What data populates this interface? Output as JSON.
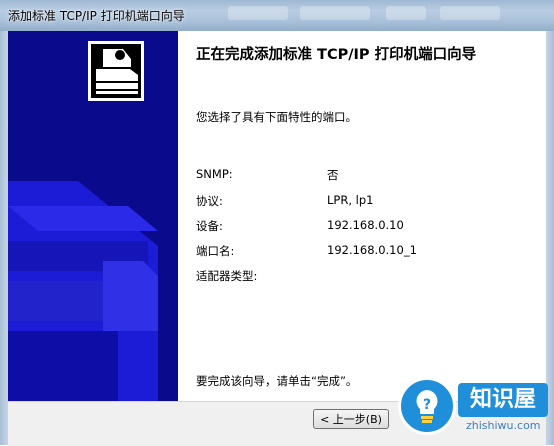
{
  "window": {
    "title": "添加标准 TCP/IP 打印机端口向导"
  },
  "wizard": {
    "heading": "正在完成添加标准 TCP/IP 打印机端口向导",
    "intro": "您选择了具有下面特性的端口。",
    "details": [
      {
        "label": "SNMP:",
        "value": "否"
      },
      {
        "label": "协议:",
        "value": "LPR, lp1"
      },
      {
        "label": "设备:",
        "value": "192.168.0.10"
      },
      {
        "label": "端口名:",
        "value": "192.168.0.10_1"
      },
      {
        "label": "适配器类型:",
        "value": ""
      }
    ],
    "finish_note": "要完成该向导，请单击“完成”。"
  },
  "buttons": {
    "back": "< 上一步(B)"
  },
  "watermark": {
    "brand": "知识屋",
    "site": "zhishiwu.com"
  },
  "colors": {
    "banner_blue": "#0a0a8c",
    "watermark_blue": "#1f8fd9"
  }
}
